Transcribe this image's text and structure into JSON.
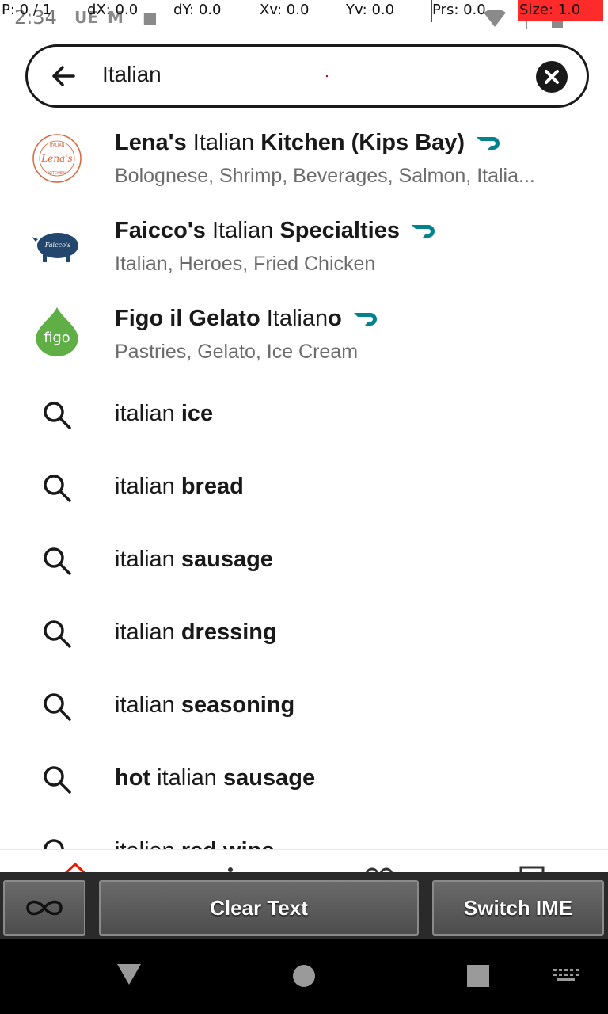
{
  "status_bar": {
    "clock": "2:34",
    "overlay": {
      "p": "P: 0 / 1",
      "dx": "dX: 0.0",
      "dy": "dY: 0.0",
      "xv": "Xv: 0.0",
      "yv": "Yv: 0.0",
      "prs": "Prs: 0.0",
      "size": "Size: 1.0"
    }
  },
  "search": {
    "query": "Italian",
    "back_icon": "arrow-left-icon",
    "clear_icon": "close-icon"
  },
  "stores": [
    {
      "name_pre": "Lena's",
      "name_mid": "Italian",
      "name_post": "Kitchen (Kips Bay)",
      "tags": "Bolognese, Shrimp, Beverages, Salmon, Italia...",
      "logo_text": "Lena's",
      "logo_ring_top": "ITALIAN",
      "logo_ring_bottom": "KITCHEN",
      "badge_icon": "dashpass-icon"
    },
    {
      "name_pre": "Faicco's",
      "name_mid": "Italian",
      "name_post": "Specialties",
      "tags": "Italian, Heroes, Fried Chicken",
      "logo_text": "Faicco's",
      "badge_icon": "dashpass-icon"
    },
    {
      "name_pre": "Figo il Gelato",
      "name_mid": "Italian",
      "name_post": "o",
      "tags": "Pastries, Gelato, Ice Cream",
      "logo_text": "figo",
      "badge_icon": "dashpass-icon"
    }
  ],
  "suggestions": [
    {
      "pre": "",
      "plain": "italian",
      "bold": "ice"
    },
    {
      "pre": "",
      "plain": "italian",
      "bold": "bread"
    },
    {
      "pre": "",
      "plain": "italian",
      "bold": "sausage"
    },
    {
      "pre": "",
      "plain": "italian",
      "bold": "dressing"
    },
    {
      "pre": "",
      "plain": "italian",
      "bold": "seasoning"
    },
    {
      "pre": "hot",
      "plain": "italian",
      "bold": "sausage"
    },
    {
      "pre": "",
      "plain": "italian",
      "bold": "red wine"
    }
  ],
  "ime_toolbar": {
    "infinity_icon": "infinity-icon",
    "clear_text": "Clear Text",
    "switch_ime": "Switch IME"
  },
  "system_nav": {
    "back_icon": "triangle-back-icon",
    "home_icon": "circle-home-icon",
    "recents_icon": "square-recents-icon",
    "keyboard_icon": "keyboard-icon"
  },
  "colors": {
    "text": "#191919",
    "secondary": "#6b6b6b",
    "dashpass": "#00838a",
    "figo_green": "#5fae46",
    "lena_orange": "#d9643a",
    "faicco_blue": "#23466e"
  }
}
